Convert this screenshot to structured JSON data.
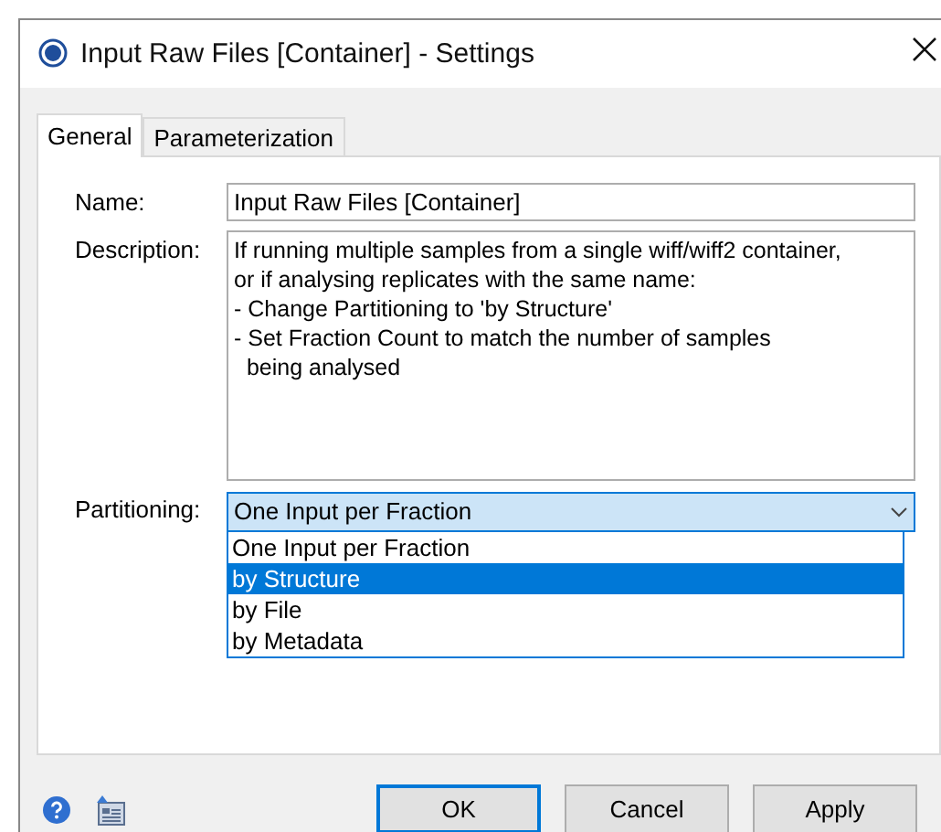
{
  "window": {
    "title": "Input Raw Files [Container] - Settings"
  },
  "tabs": [
    {
      "label": "General",
      "selected": true
    },
    {
      "label": "Parameterization",
      "selected": false
    }
  ],
  "fields": {
    "name": {
      "label": "Name:",
      "value": "Input Raw Files [Container]"
    },
    "description": {
      "label": "Description:",
      "value": "If running multiple samples from a single wiff/wiff2 container,\nor if analysing replicates with the same name:\n- Change Partitioning to 'by Structure'\n- Set Fraction Count to match the number of samples\n  being analysed"
    },
    "partitioning": {
      "label": "Partitioning:",
      "value": "One Input per Fraction",
      "expanded": true,
      "options": [
        {
          "label": "One Input per Fraction",
          "highlighted": false
        },
        {
          "label": "by Structure",
          "highlighted": true
        },
        {
          "label": "by File",
          "highlighted": false
        },
        {
          "label": "by Metadata",
          "highlighted": false
        }
      ]
    }
  },
  "buttons": [
    {
      "label": "OK",
      "default": true
    },
    {
      "label": "Cancel",
      "default": false
    },
    {
      "label": "Apply",
      "default": false
    }
  ]
}
